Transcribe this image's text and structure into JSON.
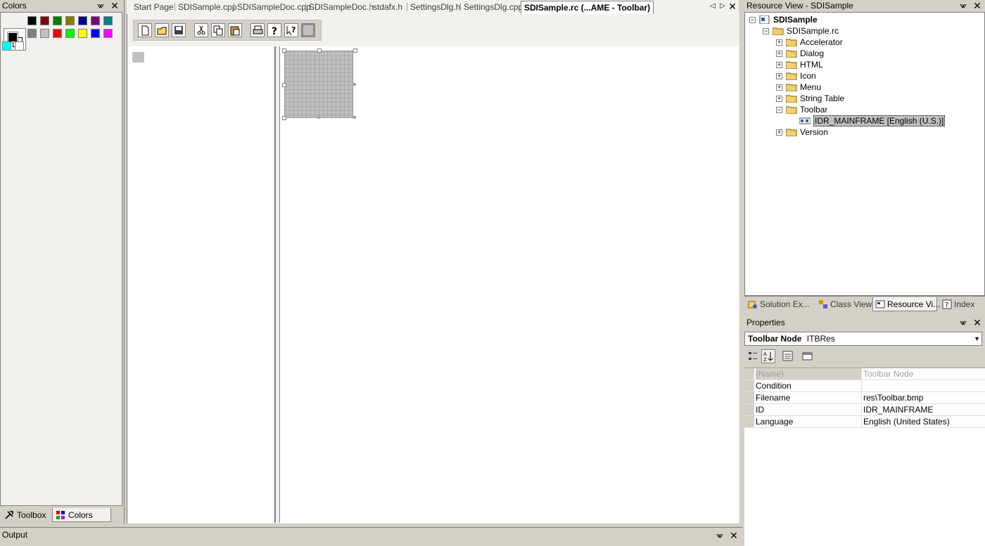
{
  "colors_panel": {
    "title": "Colors",
    "swatches": [
      "#000000",
      "#800000",
      "#008000",
      "#808000",
      "#000080",
      "#800080",
      "#008080",
      "#808080",
      "#c0c0c0",
      "#ff0000",
      "#00ff00",
      "#ffff00",
      "#0000ff",
      "#ff00ff",
      "#00ffff",
      "#ffffff"
    ],
    "tabs": [
      {
        "label": "Toolbox",
        "icon": "toolbox-icon"
      },
      {
        "label": "Colors",
        "icon": "colors-icon"
      }
    ]
  },
  "document_tabs": [
    {
      "label": "Start Page",
      "active": false
    },
    {
      "label": "SDISample.cpp",
      "active": false
    },
    {
      "label": "SDISampleDoc.cpp",
      "active": false
    },
    {
      "label": "SDISampleDoc.h",
      "active": false
    },
    {
      "label": "stdafx.h",
      "active": false
    },
    {
      "label": "SettingsDlg.h",
      "active": false
    },
    {
      "label": "SettingsDlg.cpp",
      "active": false
    },
    {
      "label": "SDISample.rc (...AME - Toolbar)",
      "active": true
    }
  ],
  "toolbar_editor": {
    "icons": [
      "new-icon",
      "open-icon",
      "save-icon",
      "cut-icon",
      "copy-icon",
      "paste-icon",
      "print-icon",
      "help-icon",
      "context-help-icon",
      "blank-button-icon"
    ]
  },
  "resource_view": {
    "title": "Resource View - SDISample",
    "tree": [
      {
        "label": "SDISample",
        "level": 0,
        "expander": "−",
        "bold": true
      },
      {
        "label": "SDISample.rc",
        "level": 1,
        "expander": "−"
      },
      {
        "label": "Accelerator",
        "level": 2,
        "expander": "+"
      },
      {
        "label": "Dialog",
        "level": 2,
        "expander": "+"
      },
      {
        "label": "HTML",
        "level": 2,
        "expander": "+"
      },
      {
        "label": "Icon",
        "level": 2,
        "expander": "+"
      },
      {
        "label": "Menu",
        "level": 2,
        "expander": "+"
      },
      {
        "label": "String Table",
        "level": 2,
        "expander": "+"
      },
      {
        "label": "Toolbar",
        "level": 2,
        "expander": "−"
      },
      {
        "label": "IDR_MAINFRAME [English (U.S.)]",
        "level": 3,
        "expander": "",
        "selected": true
      },
      {
        "label": "Version",
        "level": 2,
        "expander": "+"
      }
    ],
    "tabs": [
      {
        "label": "Solution Ex...",
        "active": false
      },
      {
        "label": "Class View",
        "active": false
      },
      {
        "label": "Resource Vi...",
        "active": true
      },
      {
        "label": "Index",
        "active": false
      }
    ]
  },
  "properties": {
    "title": "Properties",
    "object_name": "Toolbar Node",
    "object_type": "ITBRes",
    "rows": [
      {
        "name": "(Name)",
        "value": "Toolbar Node",
        "disabled": true
      },
      {
        "name": "Condition",
        "value": ""
      },
      {
        "name": "Filename",
        "value": "res\\Toolbar.bmp"
      },
      {
        "name": "ID",
        "value": "IDR_MAINFRAME"
      },
      {
        "name": "Language",
        "value": "English (United States)"
      }
    ]
  },
  "output": {
    "title": "Output"
  }
}
